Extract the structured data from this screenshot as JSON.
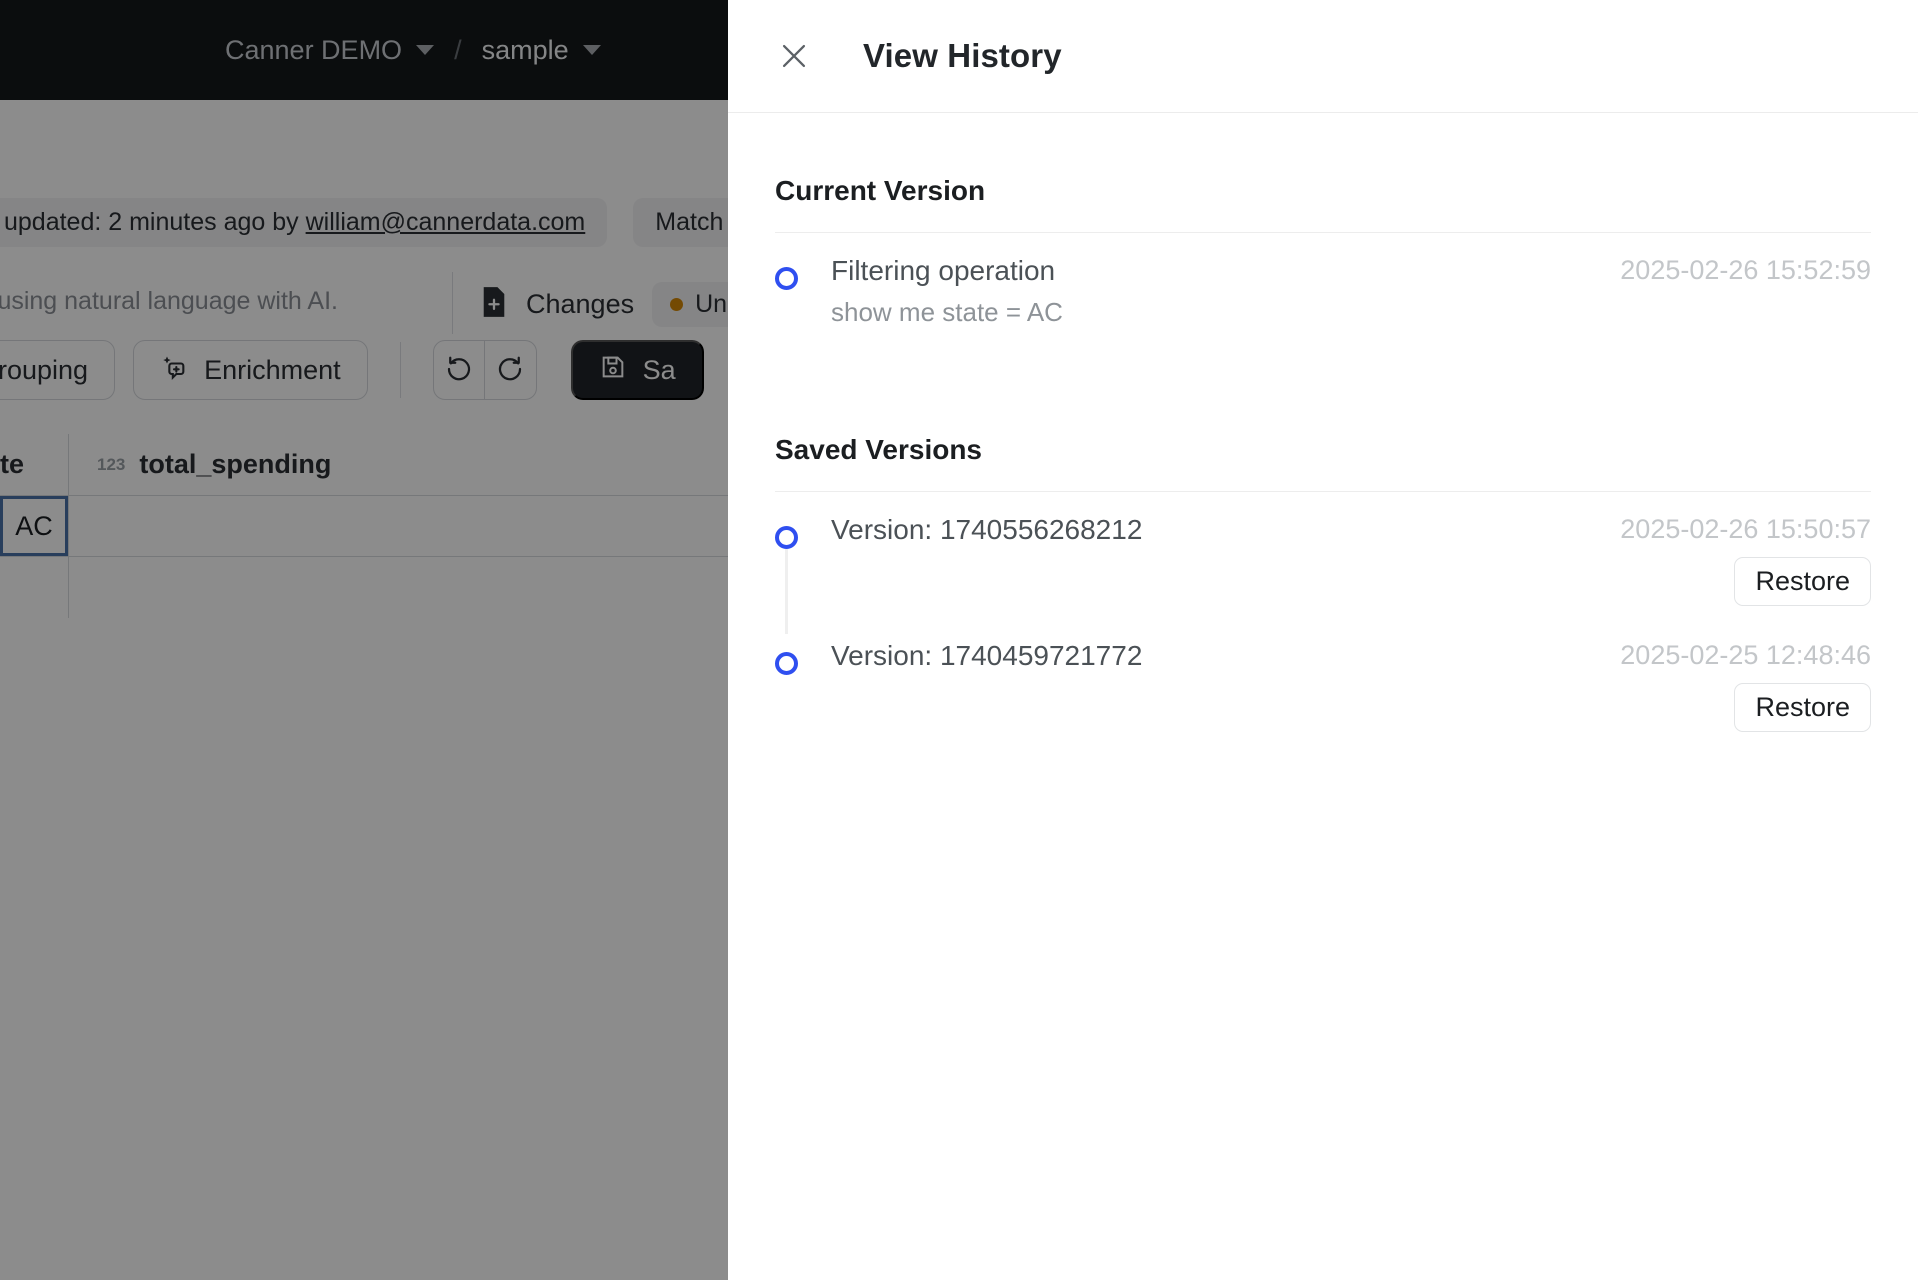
{
  "background": {
    "breadcrumb": {
      "workspace": "Canner DEMO",
      "separator": "/",
      "dataset": "sample",
      "caret_icon": "chevron-down-icon"
    },
    "meta": {
      "updated_text": "updated: 2 minutes ago by",
      "updated_email": "william@cannerdata.com",
      "match_chip": "Match"
    },
    "subtitle": "s using natural language with AI.",
    "changes": {
      "label": "Changes",
      "status_pill": "Un",
      "status_dot_color": "#d48806"
    },
    "toolbar": {
      "grouping_label": "Grouping",
      "enrichment_label": "Enrichment",
      "enrichment_icon": "sparkle-magic-icon",
      "undo_icon": "undo-icon",
      "redo_icon": "redo-icon",
      "save_label": "Sa",
      "save_icon": "floppy-disk-save-icon"
    },
    "table": {
      "columns": [
        {
          "label": "te",
          "type_icon": ""
        },
        {
          "label": "total_spending",
          "type_icon": "123"
        }
      ],
      "selected_cell_value": "AC",
      "selection_border_color": "#4a72a8"
    }
  },
  "drawer": {
    "close_icon": "close-icon",
    "title": "View History",
    "sections": [
      {
        "title": "Current Version",
        "items": [
          {
            "primary": "Filtering operation",
            "secondary": "show me state = AC",
            "timestamp": "2025-02-26 15:52:59",
            "marker_icon": "timeline-dot-icon",
            "restore_label": null
          }
        ]
      },
      {
        "title": "Saved Versions",
        "items": [
          {
            "primary": "Version: 1740556268212",
            "secondary": null,
            "timestamp": "2025-02-26 15:50:57",
            "marker_icon": "timeline-dot-icon",
            "restore_label": "Restore"
          },
          {
            "primary": "Version: 1740459721772",
            "secondary": null,
            "timestamp": "2025-02-25 12:48:46",
            "marker_icon": "timeline-dot-icon",
            "restore_label": "Restore"
          }
        ]
      }
    ],
    "accent_color": "#2f4ff0"
  }
}
